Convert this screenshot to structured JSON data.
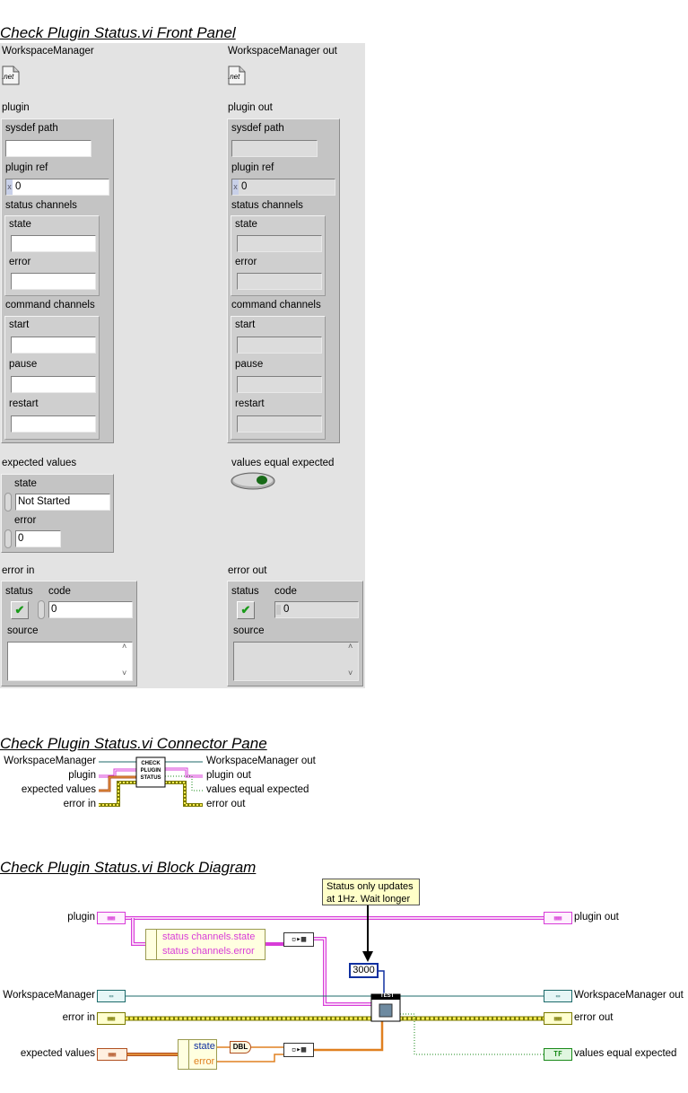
{
  "headings": {
    "front_panel": "Check Plugin Status.vi Front Panel",
    "connector_pane": "Check Plugin Status.vi Connector Pane",
    "block_diagram": "Check Plugin Status.vi Block Diagram"
  },
  "front_panel": {
    "workspace_in": {
      "label": "WorkspaceManager",
      "icon_text": ".net"
    },
    "workspace_out": {
      "label": "WorkspaceManager out",
      "icon_text": ".net"
    },
    "plugin": {
      "label": "plugin",
      "sysdef_path": "sysdef path",
      "plugin_ref": "plugin ref",
      "ref_prefix": "x",
      "ref_value": "0",
      "status_channels": "status channels",
      "state": "state",
      "error": "error",
      "command_channels": "command channels",
      "start": "start",
      "pause": "pause",
      "restart": "restart"
    },
    "plugin_out": {
      "label": "plugin out",
      "sysdef_path": "sysdef path",
      "plugin_ref": "plugin ref",
      "ref_prefix": "x",
      "ref_value": "0",
      "status_channels": "status channels",
      "state": "state",
      "error": "error",
      "command_channels": "command channels",
      "start": "start",
      "pause": "pause",
      "restart": "restart"
    },
    "expected_values": {
      "label": "expected values",
      "state_label": "state",
      "state_value": "Not Started",
      "error_label": "error",
      "error_value": "0"
    },
    "values_equal_expected": {
      "label": "values equal expected"
    },
    "error_in": {
      "label": "error in",
      "status": "status",
      "code": "code",
      "code_value": "0",
      "source": "source"
    },
    "error_out": {
      "label": "error out",
      "status": "status",
      "code": "code",
      "code_value": "0",
      "source": "source"
    },
    "checkmark": "✔",
    "scroll_up": "˄",
    "scroll_down": "˅"
  },
  "connector_pane": {
    "left": [
      "WorkspaceManager",
      "plugin",
      "expected values",
      "error in"
    ],
    "right": [
      "WorkspaceManager out",
      "plugin out",
      "values equal expected",
      "error out"
    ],
    "icon_lines": [
      "CHECK",
      "PLUGIN",
      "STATUS"
    ]
  },
  "block_diagram": {
    "comment": "Status only updates at 1Hz. Wait longer",
    "wait_value": "3000",
    "inputs": {
      "plugin": "plugin",
      "workspace": "WorkspaceManager",
      "error_in": "error in",
      "expected": "expected values"
    },
    "outputs": {
      "plugin_out": "plugin out",
      "workspace_out": "WorkspaceManager out",
      "error_out": "error out",
      "values_equal": "values equal expected"
    },
    "unbundle1": [
      "status channels.state",
      "status channels.error"
    ],
    "unbundle2": [
      "state",
      "error"
    ],
    "dbl_label": "DBL",
    "test_label": "TEST",
    "tf_label": "TF",
    "colors": {
      "plugin_wire": "#d83cd8",
      "error_wire": "#7a7a00",
      "error_wire_fill": "#ffee55",
      "ref_wire": "#1c6a6a",
      "orange_wire": "#e08020",
      "bool_wire": "#1a8a1a",
      "wait_const": "#1030a0"
    }
  }
}
